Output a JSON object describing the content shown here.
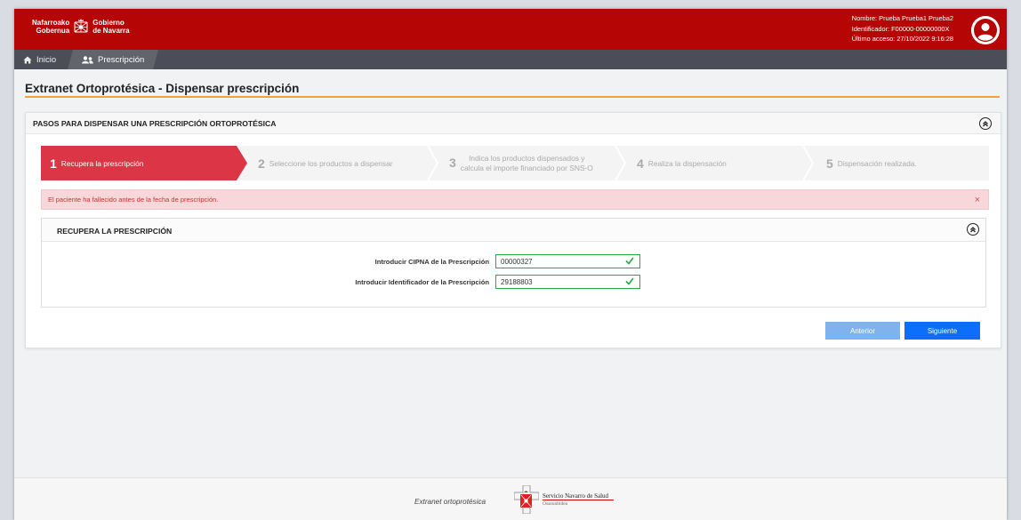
{
  "header": {
    "logo_line1a": "Nafarroako",
    "logo_line1b": "Gobernua",
    "logo_line2a": "Gobierno",
    "logo_line2b": "de Navarra",
    "user_name": "Nombre: Prueba Prueba1 Prueba2",
    "user_id": "Identificador: F00000-00000000X",
    "last_access": "Último acceso: 27/10/2022 9:16:28"
  },
  "nav": {
    "home": "Inicio",
    "prescription": "Prescripción"
  },
  "page": {
    "title": "Extranet Ortoprotésica - Dispensar prescripción"
  },
  "steps_card": {
    "title": "PASOS PARA DISPENSAR UNA PRESCRIPCIÓN ORTOPROTÉSICA",
    "steps": [
      {
        "num": "1",
        "label": "Recupera la prescripción"
      },
      {
        "num": "2",
        "label": "Seleccione los productos a dispensar"
      },
      {
        "num": "3",
        "label_line1": "Indica los productos dispensados y",
        "label_line2": "calcula el importe financiado por SNS-O"
      },
      {
        "num": "4",
        "label": "Realiza la dispensación"
      },
      {
        "num": "5",
        "label": "Dispensación realizada."
      }
    ]
  },
  "alert": {
    "message": "El paciente ha fallecido antes de la fecha de prescripción.",
    "close": "×"
  },
  "recover": {
    "title": "RECUPERA LA PRESCRIPCIÓN",
    "cipna_label": "Introducir CIPNA de la Prescripción",
    "cipna_value": "00000327",
    "id_label": "Introducir Identificador de la Prescripción",
    "id_value": "29188803"
  },
  "buttons": {
    "prev": "Anterior",
    "next": "Siguiente"
  },
  "footer": {
    "text": "Extranet ortoprotésica",
    "sns_name": "Servicio Navarro de Salud",
    "sns_sub": "Osasunbidea"
  },
  "colors": {
    "header": "#b50505",
    "nav": "#4b4e56",
    "accent_rule": "#f0a532",
    "step_active": "#dc3545",
    "success": "#28a745",
    "primary": "#0d6efd"
  }
}
